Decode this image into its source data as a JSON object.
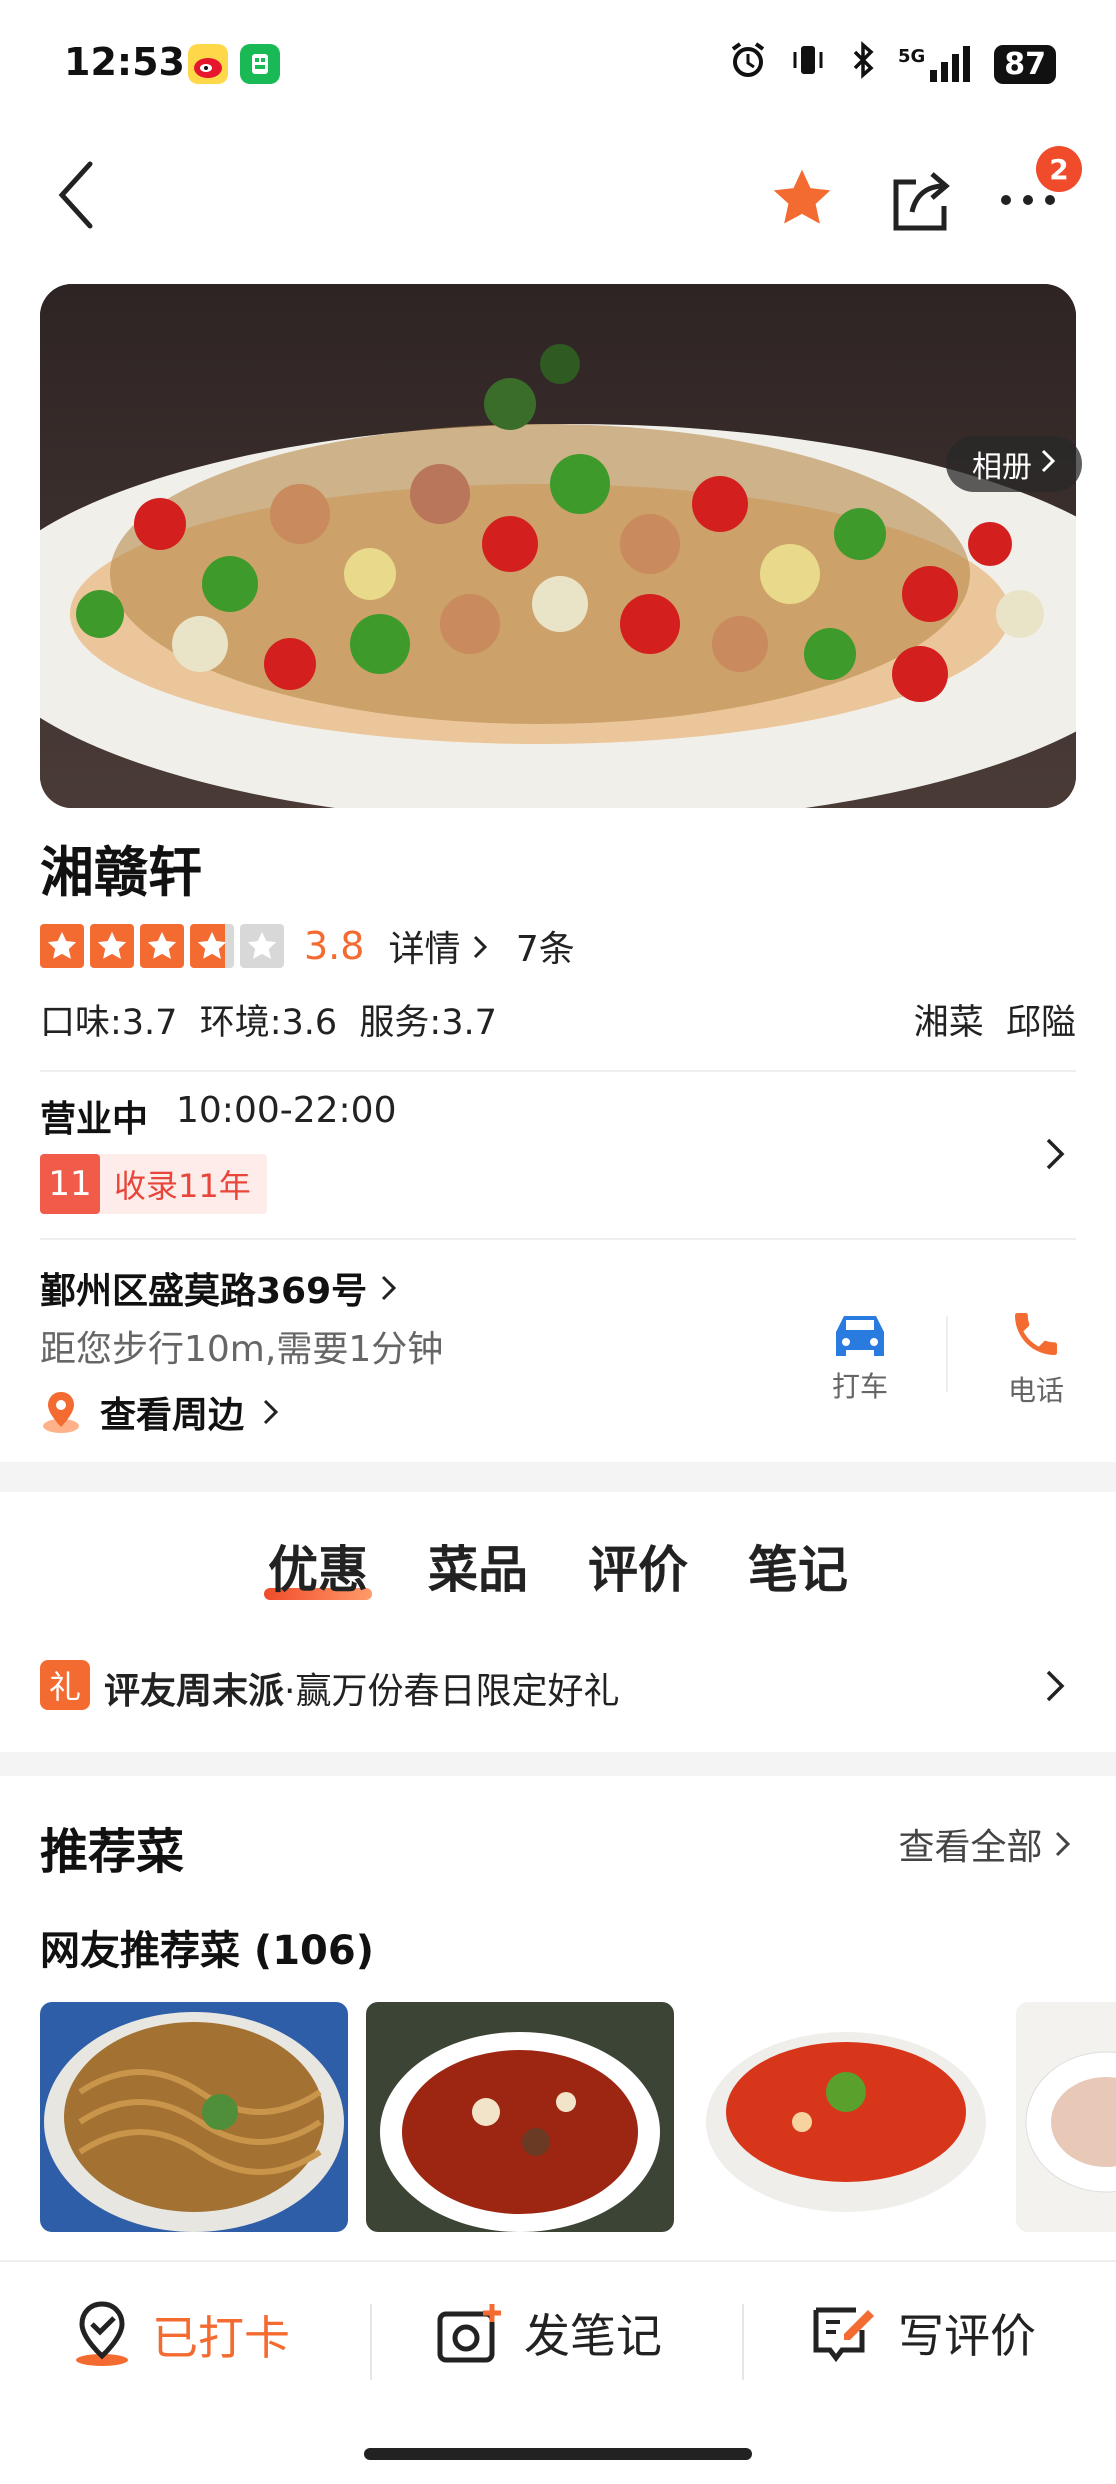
{
  "status_bar": {
    "time": "12:53",
    "network": "5G",
    "battery": "87"
  },
  "nav": {
    "notification_count": "2"
  },
  "hero": {
    "album_label": "相册"
  },
  "restaurant": {
    "name": "湘赣轩",
    "rating": 3.8,
    "rating_text": "3.8",
    "detail_label": "详情",
    "review_count": "7条",
    "subscores": "口味:3.7  环境:3.6  服务:3.7",
    "categories": "湘菜  邱隘",
    "status": "营业中",
    "hours": "10:00-22:00",
    "years_badge": "11",
    "years_text": "收录11年",
    "address": "鄞州区盛莫路369号",
    "distance": "距您步行10m,需要1分钟",
    "nearby": "查看周边"
  },
  "actions": {
    "taxi": "打车",
    "phone": "电话"
  },
  "tabs": [
    "优惠",
    "菜品",
    "评价",
    "笔记"
  ],
  "promo": {
    "icon": "礼",
    "title": "评友周末派",
    "text": "·赢万份春日限定好礼"
  },
  "recommend": {
    "title": "推荐菜",
    "view_all": "查看全部",
    "subtitle": "网友推荐菜 (106)"
  },
  "bottom_bar": {
    "checked_in": "已打卡",
    "post_note": "发笔记",
    "write_review": "写评价"
  },
  "colors": {
    "accent": "#f46b32",
    "badge": "#f04b2a",
    "taxi_blue": "#2a7be0"
  }
}
